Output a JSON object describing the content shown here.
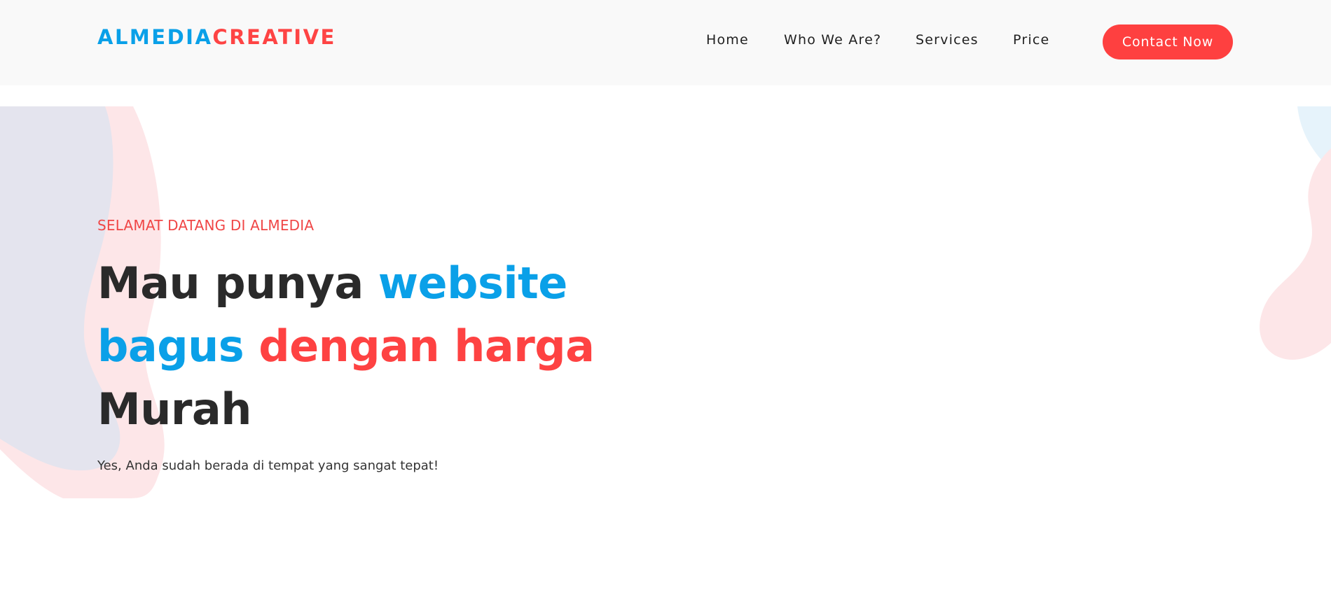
{
  "brand": {
    "logo_part1": "ALMEDIA",
    "logo_part2": "CREATIVE",
    "colors": {
      "blue": "#0aa0e8",
      "red": "#fe4444",
      "dark": "#2a2a2a",
      "header_bg": "#f9f9f9"
    }
  },
  "nav": {
    "items": [
      {
        "label": "Home"
      },
      {
        "label": "Who We Are?"
      },
      {
        "label": "Services"
      },
      {
        "label": "Price"
      }
    ],
    "cta_label": "Contact Now"
  },
  "hero": {
    "eyebrow": "SELAMAT DATANG DI ALMEDIA",
    "headline": {
      "line1_dark": "Mau punya ",
      "line1_blue": "website",
      "line2_blue": "bagus ",
      "line2_red": "dengan harga",
      "line3_dark": "Murah"
    },
    "tagline": "Yes, Anda sudah berada di tempat yang sangat tepat!"
  },
  "decor": {
    "left_blob": "decorative-blob",
    "right_blob": "decorative-blob"
  }
}
